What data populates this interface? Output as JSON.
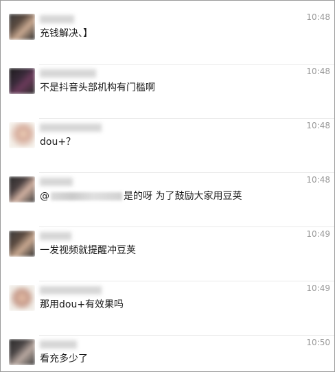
{
  "messages": [
    {
      "name": "",
      "time": "10:48",
      "text": "充钱解决、】"
    },
    {
      "name": "",
      "time": "10:48",
      "text": "不是抖音头部机构有门槛啊"
    },
    {
      "name": "",
      "time": "10:48",
      "text": "dou+？"
    },
    {
      "name": "",
      "time": "10:48",
      "text_prefix": "@",
      "text_suffix": "是的呀 为了鼓励大家用豆荚"
    },
    {
      "name": "",
      "time": "10:49",
      "text": "一发视频就提醒冲豆荚"
    },
    {
      "name": "",
      "time": "10:49",
      "text": "那用dou+有效果吗"
    },
    {
      "name": "",
      "time": "10:50",
      "text": "看充多少了"
    }
  ],
  "colors": {
    "background": "#ffffff",
    "time_text": "#999999",
    "message_text": "#1a1a1a",
    "divider": "#e9e9e9",
    "window_border": "#9a9a9a"
  }
}
